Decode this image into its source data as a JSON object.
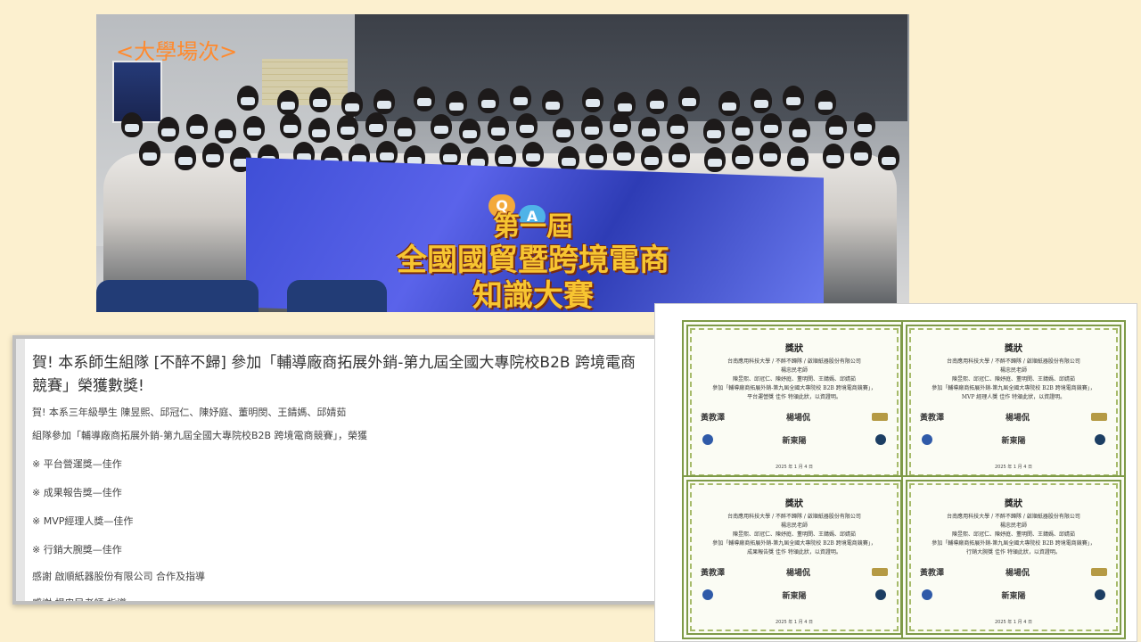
{
  "photo": {
    "caption": "<大學場次>",
    "banner_line1": "第一屆",
    "banner_line2": "全國國貿暨跨境電商",
    "banner_line3": "知識大賽",
    "qa_q": "Q",
    "qa_a": "A"
  },
  "news": {
    "headline": "賀! 本系師生組隊 [不醉不歸] 參加「輔導廠商拓展外銷-第九屆全國大專院校B2B 跨境電商競賽」榮獲數獎!",
    "intro_line1": "賀! 本系三年級學生 陳昱熙、邱冠仁、陳妤庭、董明閔、王錆媽、邱婧茹",
    "intro_line2": "組隊參加「輔導廠商拓展外銷-第九屆全國大專院校B2B 跨境電商競賽」，榮獲",
    "awards": [
      "※ 平台營運獎—佳作",
      "※ 成果報告獎—佳作",
      "※ MVP經理人獎—佳作",
      "※ 行銷大腕獎—佳作"
    ],
    "thanks1": "感謝 啟順紙器股份有限公司 合作及指導",
    "thanks2": "感謝 楊忠民老師 指導"
  },
  "certificates": [
    {
      "title": "獎狀",
      "org": "台南應用科技大學 / 不醉不歸隊 / 啟順紙器股份有限公司",
      "teacher": "楊忠民老師",
      "members": "陳昱熙、邱冠仁、陳妤庭、董明閔、王錆媽、邱婧茹",
      "event": "參加「輔導廠商拓展外銷-第九屆全國大專院校 B2B 跨境電商競賽」，",
      "award": "平台運營獎 佳作 特頒此狀，以資證明。",
      "sig1": "黃教澤",
      "sig2": "楊場侃",
      "brand": "新東陽",
      "date": "2025 年 1 月 4 日"
    },
    {
      "title": "獎狀",
      "org": "台南應用科技大學 / 不醉不歸隊 / 啟順紙器股份有限公司",
      "teacher": "楊忠民老師",
      "members": "陳昱熙、邱冠仁、陳妤庭、董明閔、王錆媽、邱婧茹",
      "event": "參加「輔導廠商拓展外銷-第九屆全國大專院校 B2B 跨境電商競賽」，",
      "award": "MVP 經理人獎 佳作 特頒此狀，以資證明。",
      "sig1": "黃教澤",
      "sig2": "楊場侃",
      "brand": "新東陽",
      "date": "2025 年 1 月 4 日"
    },
    {
      "title": "獎狀",
      "org": "台南應用科技大學 / 不醉不歸隊 / 啟順紙器股份有限公司",
      "teacher": "楊忠民老師",
      "members": "陳昱熙、邱冠仁、陳妤庭、董明閔、王錆媽、邱婧茹",
      "event": "參加「輔導廠商拓展外銷-第九屆全國大專院校 B2B 跨境電商競賽」，",
      "award": "成果報告獎 佳作 特頒此狀，以資證明。",
      "sig1": "黃教澤",
      "sig2": "楊場侃",
      "brand": "新東陽",
      "date": "2025 年 1 月 4 日"
    },
    {
      "title": "獎狀",
      "org": "台南應用科技大學 / 不醉不歸隊 / 啟順紙器股份有限公司",
      "teacher": "楊忠民老師",
      "members": "陳昱熙、邱冠仁、陳妤庭、董明閔、王錆媽、邱婧茹",
      "event": "參加「輔導廠商拓展外銷-第九屆全國大專院校 B2B 跨境電商競賽」，",
      "award": "行銷大腕獎 佳作 特頒此狀，以資證明。",
      "sig1": "黃教澤",
      "sig2": "楊場侃",
      "brand": "新東陽",
      "date": "2025 年 1 月 4 日"
    }
  ]
}
